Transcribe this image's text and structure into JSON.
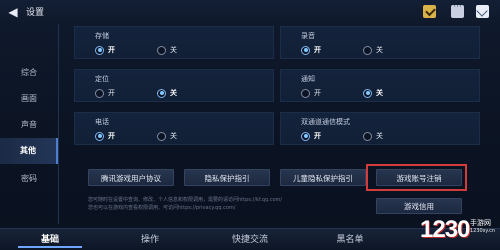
{
  "header": {
    "title": "设置",
    "icons": [
      "back-icon",
      "task-icon",
      "chat-icon",
      "mail-icon"
    ]
  },
  "sidebar": {
    "items": [
      {
        "label": "综合"
      },
      {
        "label": "画面"
      },
      {
        "label": "声音"
      },
      {
        "label": "其他",
        "active": true
      },
      {
        "label": "密码"
      }
    ]
  },
  "settings": {
    "storage": {
      "label": "存储",
      "on": "开",
      "off": "关",
      "selected": "on"
    },
    "recording": {
      "label": "录音",
      "on": "开",
      "off": "关",
      "selected": "on"
    },
    "location": {
      "label": "定位",
      "on": "开",
      "off": "关",
      "selected": "off"
    },
    "notification": {
      "label": "通知",
      "on": "开",
      "off": "关",
      "selected": "off"
    },
    "phone": {
      "label": "电话",
      "on": "开",
      "off": "关",
      "selected": "on"
    },
    "dual_channel": {
      "label": "双通道通信模式",
      "on": "开",
      "off": "关",
      "selected": "on"
    }
  },
  "buttons": {
    "user_agreement": "腾讯游戏用户协议",
    "privacy_guide": "隐私保护指引",
    "child_privacy_guide": "儿童隐私保护指引",
    "account_cancel": "游戏账号注销",
    "game_credit": "游戏信用"
  },
  "note": {
    "line1": "您可随时在设置中查询、修改、个人信息和权限调用，需要的请访问https://kf.qq.com/",
    "line2": "您也可以在游戏内查看权限调用、可访问https://privacy.qq.com/"
  },
  "tabs": [
    {
      "label": "基础",
      "active": true
    },
    {
      "label": "操作"
    },
    {
      "label": "快捷交流"
    },
    {
      "label": "黑名单"
    }
  ],
  "watermark": {
    "brand": "1230",
    "sub": "手游网",
    "url": "1230sy.cn"
  },
  "colors": {
    "accent": "#6ea6ff",
    "highlight": "#d43c3c",
    "background": "#0c1424"
  }
}
